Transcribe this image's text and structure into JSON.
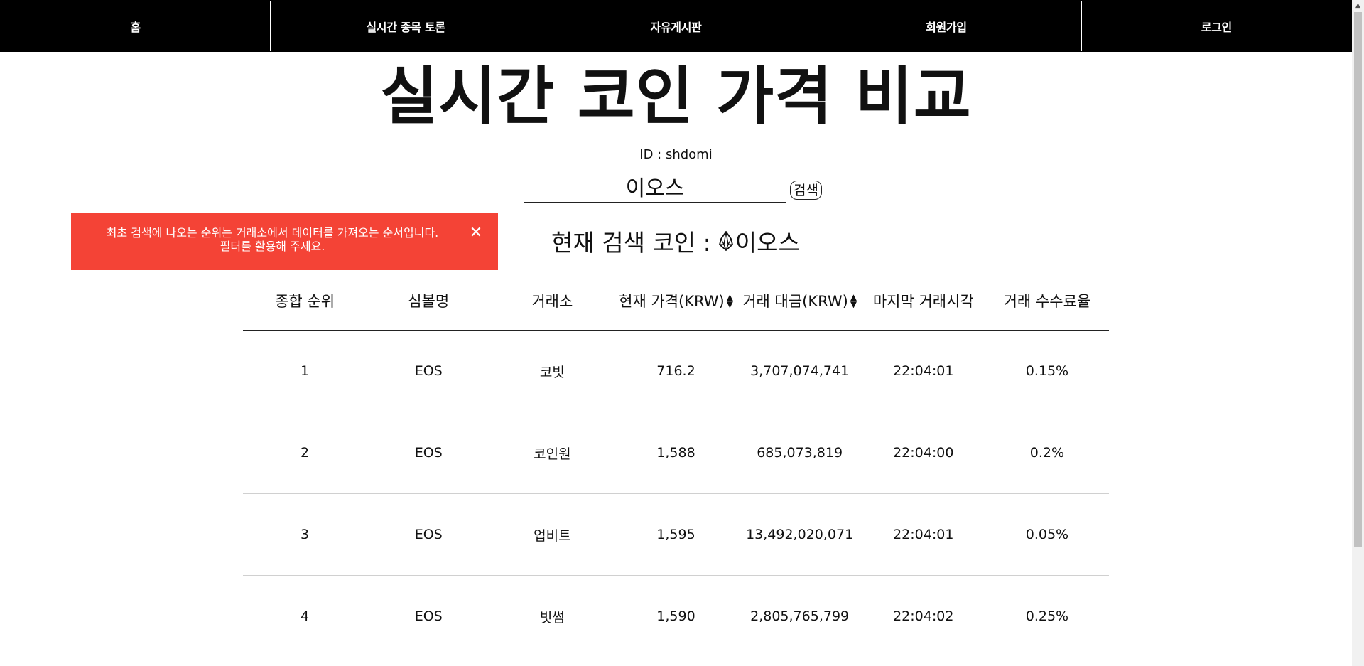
{
  "nav": {
    "items": [
      {
        "label": "홈"
      },
      {
        "label": "실시간 종목 토론"
      },
      {
        "label": "자유게시판"
      },
      {
        "label": "회원가입"
      },
      {
        "label": "로그인"
      }
    ]
  },
  "header": {
    "title": "실시간 코인 가격 비교",
    "user_id": "ID : shdomi"
  },
  "search": {
    "value": "이오스",
    "button_label": "검색"
  },
  "toast": {
    "line1": "최초 검색에 나오는 순위는 거래소에서 데이터를 가져오는 순서입니다.",
    "line2": "필터를 활용해 주세요.",
    "close_symbol": "✕"
  },
  "current_coin": {
    "label": "현재 검색 코인 :",
    "name": "이오스"
  },
  "table": {
    "headers": [
      {
        "label": "종합 순위",
        "sortable": false
      },
      {
        "label": "심볼명",
        "sortable": false
      },
      {
        "label": "거래소",
        "sortable": false
      },
      {
        "label": "현재 가격(KRW)",
        "sortable": true
      },
      {
        "label": "거래 대금(KRW)",
        "sortable": true
      },
      {
        "label": "마지막 거래시각",
        "sortable": false
      },
      {
        "label": "거래 수수료율",
        "sortable": false
      }
    ],
    "rows": [
      [
        "1",
        "EOS",
        "코빗",
        "716.2",
        "3,707,074,741",
        "22:04:01",
        "0.15%"
      ],
      [
        "2",
        "EOS",
        "코인원",
        "1,588",
        "685,073,819",
        "22:04:00",
        "0.2%"
      ],
      [
        "3",
        "EOS",
        "업비트",
        "1,595",
        "13,492,020,071",
        "22:04:01",
        "0.05%"
      ],
      [
        "4",
        "EOS",
        "빗썸",
        "1,590",
        "2,805,765,799",
        "22:04:02",
        "0.25%"
      ]
    ]
  },
  "colors": {
    "nav_bg": "#000000",
    "toast_bg": "#f44336"
  }
}
